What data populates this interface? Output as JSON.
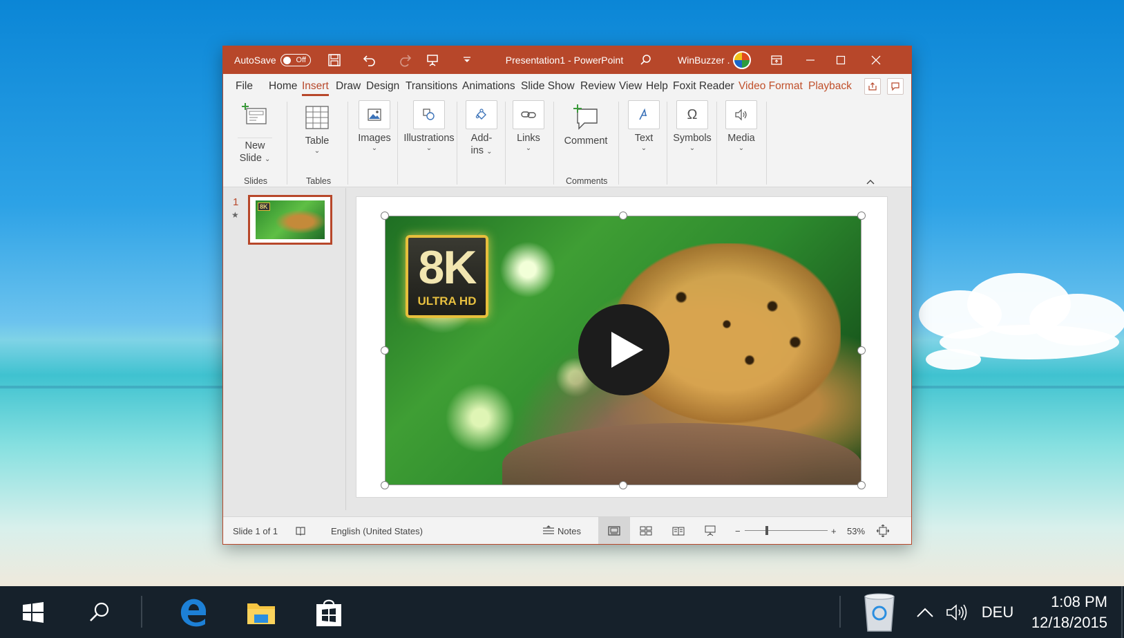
{
  "titlebar": {
    "autosave_label": "AutoSave",
    "autosave_state": "Off",
    "title": "Presentation1  -  PowerPoint",
    "user": "WinBuzzer .",
    "icons": [
      "save-icon",
      "undo-icon",
      "redo-icon",
      "present-icon",
      "customize-icon",
      "search-icon",
      "ribbon-display-icon",
      "minimize-icon",
      "maximize-icon",
      "close-icon"
    ]
  },
  "menu": {
    "tabs": [
      "File",
      "Home",
      "Insert",
      "Draw",
      "Design",
      "Transitions",
      "Animations",
      "Slide Show",
      "Review",
      "View",
      "Help",
      "Foxit Reader",
      "Video Format",
      "Playback"
    ],
    "active": "Insert",
    "contextual": [
      "Video Format",
      "Playback"
    ]
  },
  "ribbon": {
    "new_slide_l1": "New",
    "new_slide_l2": "Slide",
    "table": "Table",
    "images": "Images",
    "illustrations": "Illustrations",
    "addins_l1": "Add-",
    "addins_l2": "ins",
    "links": "Links",
    "comment": "Comment",
    "text": "Text",
    "symbols": "Symbols",
    "media": "Media",
    "groups": {
      "slides": "Slides",
      "tables": "Tables",
      "comments": "Comments"
    }
  },
  "slides_pane": {
    "number": "1",
    "star": "★",
    "thumb_badge": "8K"
  },
  "video": {
    "badge_main": "8K",
    "badge_sub": "ULTRA HD"
  },
  "statusbar": {
    "slide_info": "Slide 1 of 1",
    "language": "English (United States)",
    "notes": "Notes",
    "zoom_minus": "−",
    "zoom_plus": "+",
    "zoom": "53%"
  },
  "taskbar": {
    "lang": "DEU",
    "time": "1:08 PM",
    "date": "12/18/2015"
  },
  "colors": {
    "accent": "#b7472a",
    "taskbar": "#16212b",
    "ribbon": "#f3f3f3"
  }
}
